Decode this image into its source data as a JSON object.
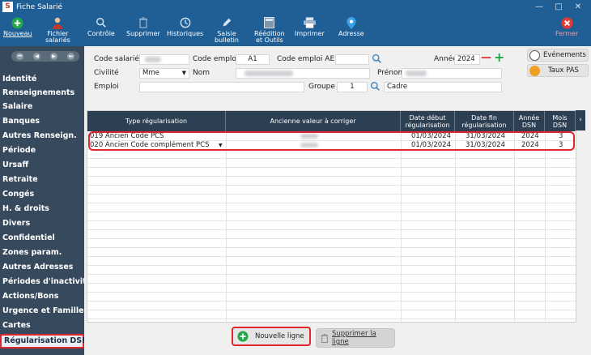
{
  "window": {
    "title": "Fiche Salarié",
    "logo": "S",
    "minimize": "—",
    "maximize": "□",
    "close": "✕"
  },
  "toolbar": {
    "nouveau": "Nouveau",
    "fichier_salaries_1": "Fichier",
    "fichier_salaries_2": "salariés",
    "controle": "Contrôle",
    "supprimer": "Supprimer",
    "historiques": "Historiques",
    "saisie_1": "Saisie",
    "saisie_2": "bulletin",
    "reedition_1": "Réédition",
    "reedition_2": "et Outils",
    "imprimer": "Imprimer",
    "adresse": "Adresse",
    "fermer": "Fermer"
  },
  "sidebar": {
    "items": [
      "Identité",
      "Renseignements",
      "Salaire",
      "Banques",
      "Autres Renseign.",
      "Période",
      "Ursaff",
      "Retraite",
      "Congés",
      "H.  & droits",
      "Divers",
      "Confidentiel",
      "Zones param.",
      "Autres Adresses",
      "Périodes d'inactivité",
      "Actions/Bons",
      "Urgence et Famille",
      "Cartes",
      "Régularisation DSN"
    ]
  },
  "form": {
    "code_salarie_label": "Code salarié",
    "code_emploi_label": "Code emploi",
    "code_emploi_value": "A1",
    "code_emploi_aem_label": "Code emploi AEM",
    "annee_label": "Année",
    "annee_value": "2024",
    "civilite_label": "Civilité",
    "civilite_value": "Mme",
    "nom_label": "Nom",
    "prenom_label": "Prénom",
    "emploi_label": "Emploi",
    "groupe_label": "Groupe",
    "groupe_value": "1",
    "cadre_value": "Cadre",
    "minus": "—",
    "plus": "+"
  },
  "side_buttons": {
    "evenements": "Evénements",
    "taux_pas": "Taux PAS"
  },
  "table": {
    "headers": [
      "Type régularisation",
      "Ancienne valeur à corriger",
      "Date début régularisation",
      "Date fin régularisation",
      "Année DSN",
      "Mois DSN"
    ],
    "rows": [
      {
        "type": "019 Ancien Code PCS",
        "debut": "01/03/2024",
        "fin": "31/03/2024",
        "annee": "2024",
        "mois": "3"
      },
      {
        "type": "020 Ancien Code complément PCS",
        "debut": "01/03/2024",
        "fin": "31/03/2024",
        "annee": "2024",
        "mois": "3"
      }
    ],
    "more_columns_arrow": "›"
  },
  "actions": {
    "nouvelle_ligne": "Nouvelle ligne",
    "supprimer_ligne": "Supprimer la ligne"
  },
  "colors": {
    "titlebar": "#1f5f96",
    "sidebar": "#37495c",
    "highlight": "#e0262f",
    "add_green": "#22a84a",
    "close_red": "#e53935"
  }
}
